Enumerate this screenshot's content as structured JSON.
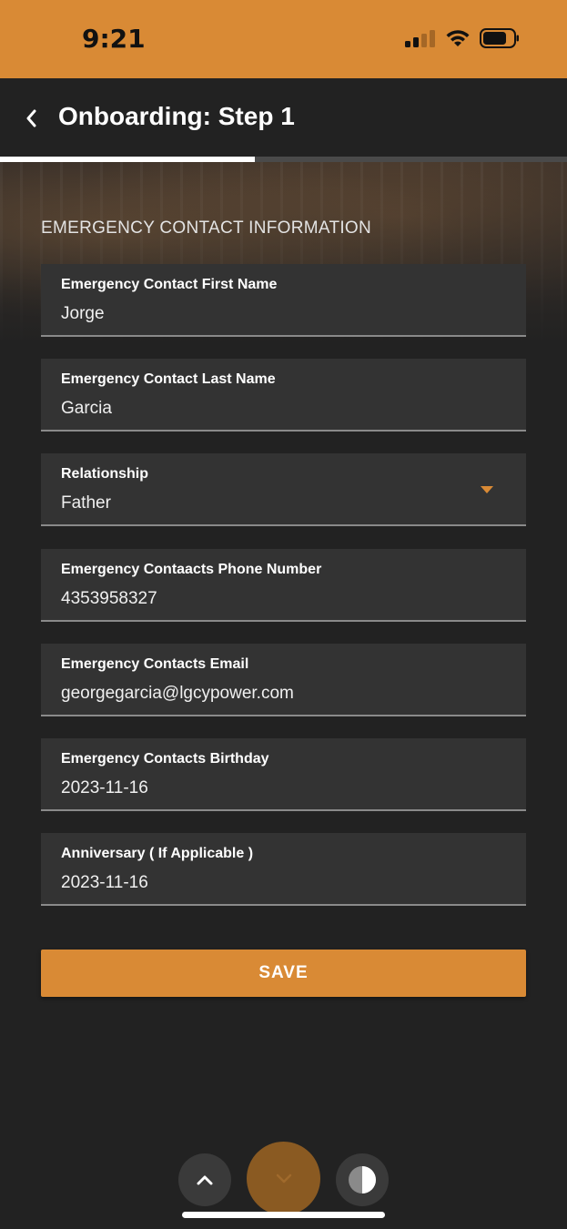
{
  "status_bar": {
    "time": "9:21",
    "icons": [
      "cellular-signal-icon",
      "wifi-icon",
      "battery-icon"
    ],
    "background_color": "#d98a35"
  },
  "header": {
    "title": "Onboarding: Step 1",
    "back_icon": "chevron-left-icon"
  },
  "progress": {
    "value": 0.45
  },
  "form": {
    "section_title": "EMERGENCY CONTACT INFORMATION",
    "fields": [
      {
        "label": "Emergency Contact First Name",
        "value": "Jorge"
      },
      {
        "label": "Emergency Contact Last Name",
        "value": "Garcia"
      },
      {
        "label": "Relationship",
        "value": "Father",
        "icon": "dropdown-caret-icon"
      },
      {
        "label": "Emergency Contaacts Phone Number",
        "value": "4353958327"
      },
      {
        "label": "Emergency Contacts Email",
        "value": "georgegarcia@lgcypower.com"
      },
      {
        "label": "Emergency Contacts Birthday",
        "value": "2023-11-16"
      },
      {
        "label": "Anniversary ( If Applicable )",
        "value": "2023-11-16"
      }
    ],
    "save_label": "SAVE"
  },
  "bottom_controls": {
    "icons": [
      "chevron-up-icon",
      "chevron-down-icon",
      "half-circle-contrast-icon"
    ]
  },
  "colors": {
    "accent": "#d98a35",
    "background": "#222222",
    "field_background": "#333333"
  }
}
